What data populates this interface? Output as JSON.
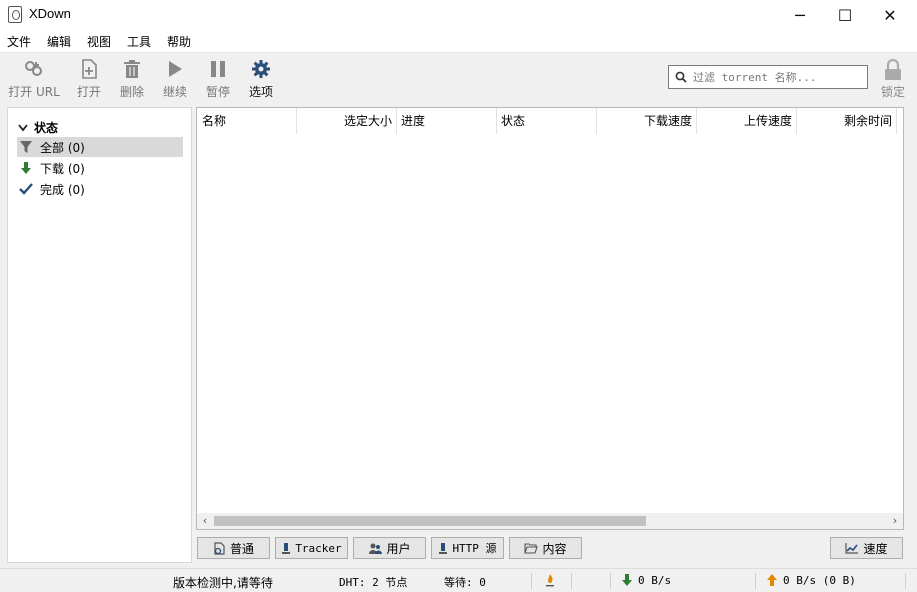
{
  "window": {
    "title": "XDown",
    "minimize": "─",
    "maximize": "☐",
    "close": "✕"
  },
  "menu": [
    "文件",
    "编辑",
    "视图",
    "工具",
    "帮助"
  ],
  "toolbar": {
    "open_url": "打开 URL",
    "open": "打开",
    "delete": "删除",
    "resume": "继续",
    "pause": "暂停",
    "options": "选项",
    "lock": "锁定"
  },
  "search": {
    "placeholder": "过滤 torrent 名称..."
  },
  "sidebar": {
    "header": "状态",
    "items": [
      {
        "label": "全部 (0)",
        "icon": "filter-icon"
      },
      {
        "label": "下载 (0)",
        "icon": "arrow-down-icon"
      },
      {
        "label": "完成 (0)",
        "icon": "check-icon"
      }
    ]
  },
  "columns": [
    "名称",
    "选定大小",
    "进度",
    "状态",
    "下载速度",
    "上传速度",
    "剩余时间"
  ],
  "rows": [],
  "tabs": {
    "general": "普通",
    "tracker": "Tracker",
    "peers": "用户",
    "http_sources": "HTTP 源",
    "content": "内容",
    "speed": "速度"
  },
  "status": {
    "update_check": "版本检测中,请等待",
    "dht": "DHT: 2 节点",
    "queued": "等待: 0",
    "download_speed": "0 B/s",
    "upload_speed": "0 B/s (0 B)"
  },
  "colors": {
    "accent": "#2a4e7a",
    "download": "#2e7d32",
    "upload": "#e08a00"
  }
}
